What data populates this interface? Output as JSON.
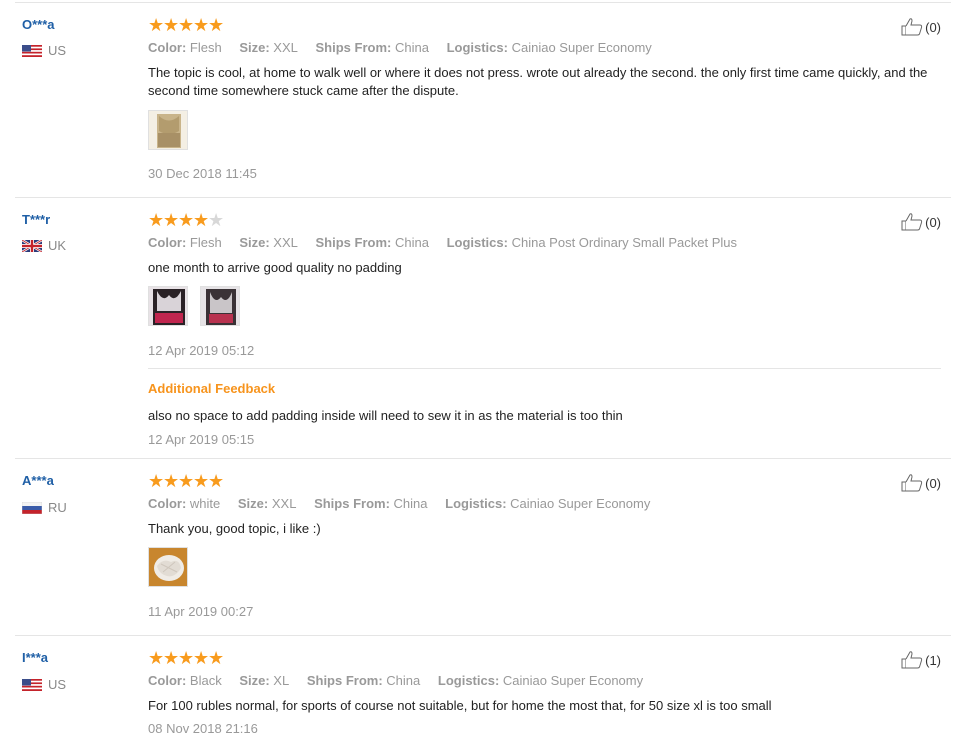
{
  "reviews": [
    {
      "user": "O***a",
      "country": "US",
      "flag": "us",
      "rating": 5,
      "attrs": [
        {
          "k": "Color:",
          "v": "Flesh"
        },
        {
          "k": "Size:",
          "v": "XXL"
        },
        {
          "k": "Ships From:",
          "v": "China"
        },
        {
          "k": "Logistics:",
          "v": "Cainiao Super Economy"
        }
      ],
      "text": "The topic is cool, at home to walk well or where it does not press. wrote out already the second. the only first time came quickly, and the second time somewhere stuck came after the dispute.",
      "date": "30 Dec 2018 11:45",
      "helpful": "(0)"
    },
    {
      "user": "T***r",
      "country": "UK",
      "flag": "uk",
      "rating": 4,
      "attrs": [
        {
          "k": "Color:",
          "v": "Flesh"
        },
        {
          "k": "Size:",
          "v": "XXL"
        },
        {
          "k": "Ships From:",
          "v": "China"
        },
        {
          "k": "Logistics:",
          "v": "China Post Ordinary Small Packet Plus"
        }
      ],
      "text": "one month to arrive good quality no padding",
      "date": "12 Apr 2019 05:12",
      "additional_label": "Additional Feedback",
      "additional_text": "also no space to add padding inside will need to sew it in as the material is too thin",
      "additional_date": "12 Apr 2019 05:15",
      "helpful": "(0)"
    },
    {
      "user": "A***a",
      "country": "RU",
      "flag": "ru",
      "rating": 5,
      "attrs": [
        {
          "k": "Color:",
          "v": "white"
        },
        {
          "k": "Size:",
          "v": "XXL"
        },
        {
          "k": "Ships From:",
          "v": "China"
        },
        {
          "k": "Logistics:",
          "v": "Cainiao Super Economy"
        }
      ],
      "text": "Thank you, good topic, i like :)",
      "date": "11 Apr 2019 00:27",
      "helpful": "(0)"
    },
    {
      "user": "I***a",
      "country": "US",
      "flag": "us",
      "rating": 5,
      "attrs": [
        {
          "k": "Color:",
          "v": "Black"
        },
        {
          "k": "Size:",
          "v": "XL"
        },
        {
          "k": "Ships From:",
          "v": "China"
        },
        {
          "k": "Logistics:",
          "v": "Cainiao Super Economy"
        }
      ],
      "text": "For 100 rubles normal, for sports of course not suitable, but for home the most that, for 50 size xl is too small",
      "date": "08 Nov 2018 21:16",
      "helpful": "(1)"
    }
  ],
  "colors": {
    "star": "#f89b1d",
    "username": "#1f5fa6",
    "additional_feedback": "#f7941d"
  },
  "icons": {
    "helpful": "thumbs-up-icon",
    "rating": "star-icon"
  }
}
